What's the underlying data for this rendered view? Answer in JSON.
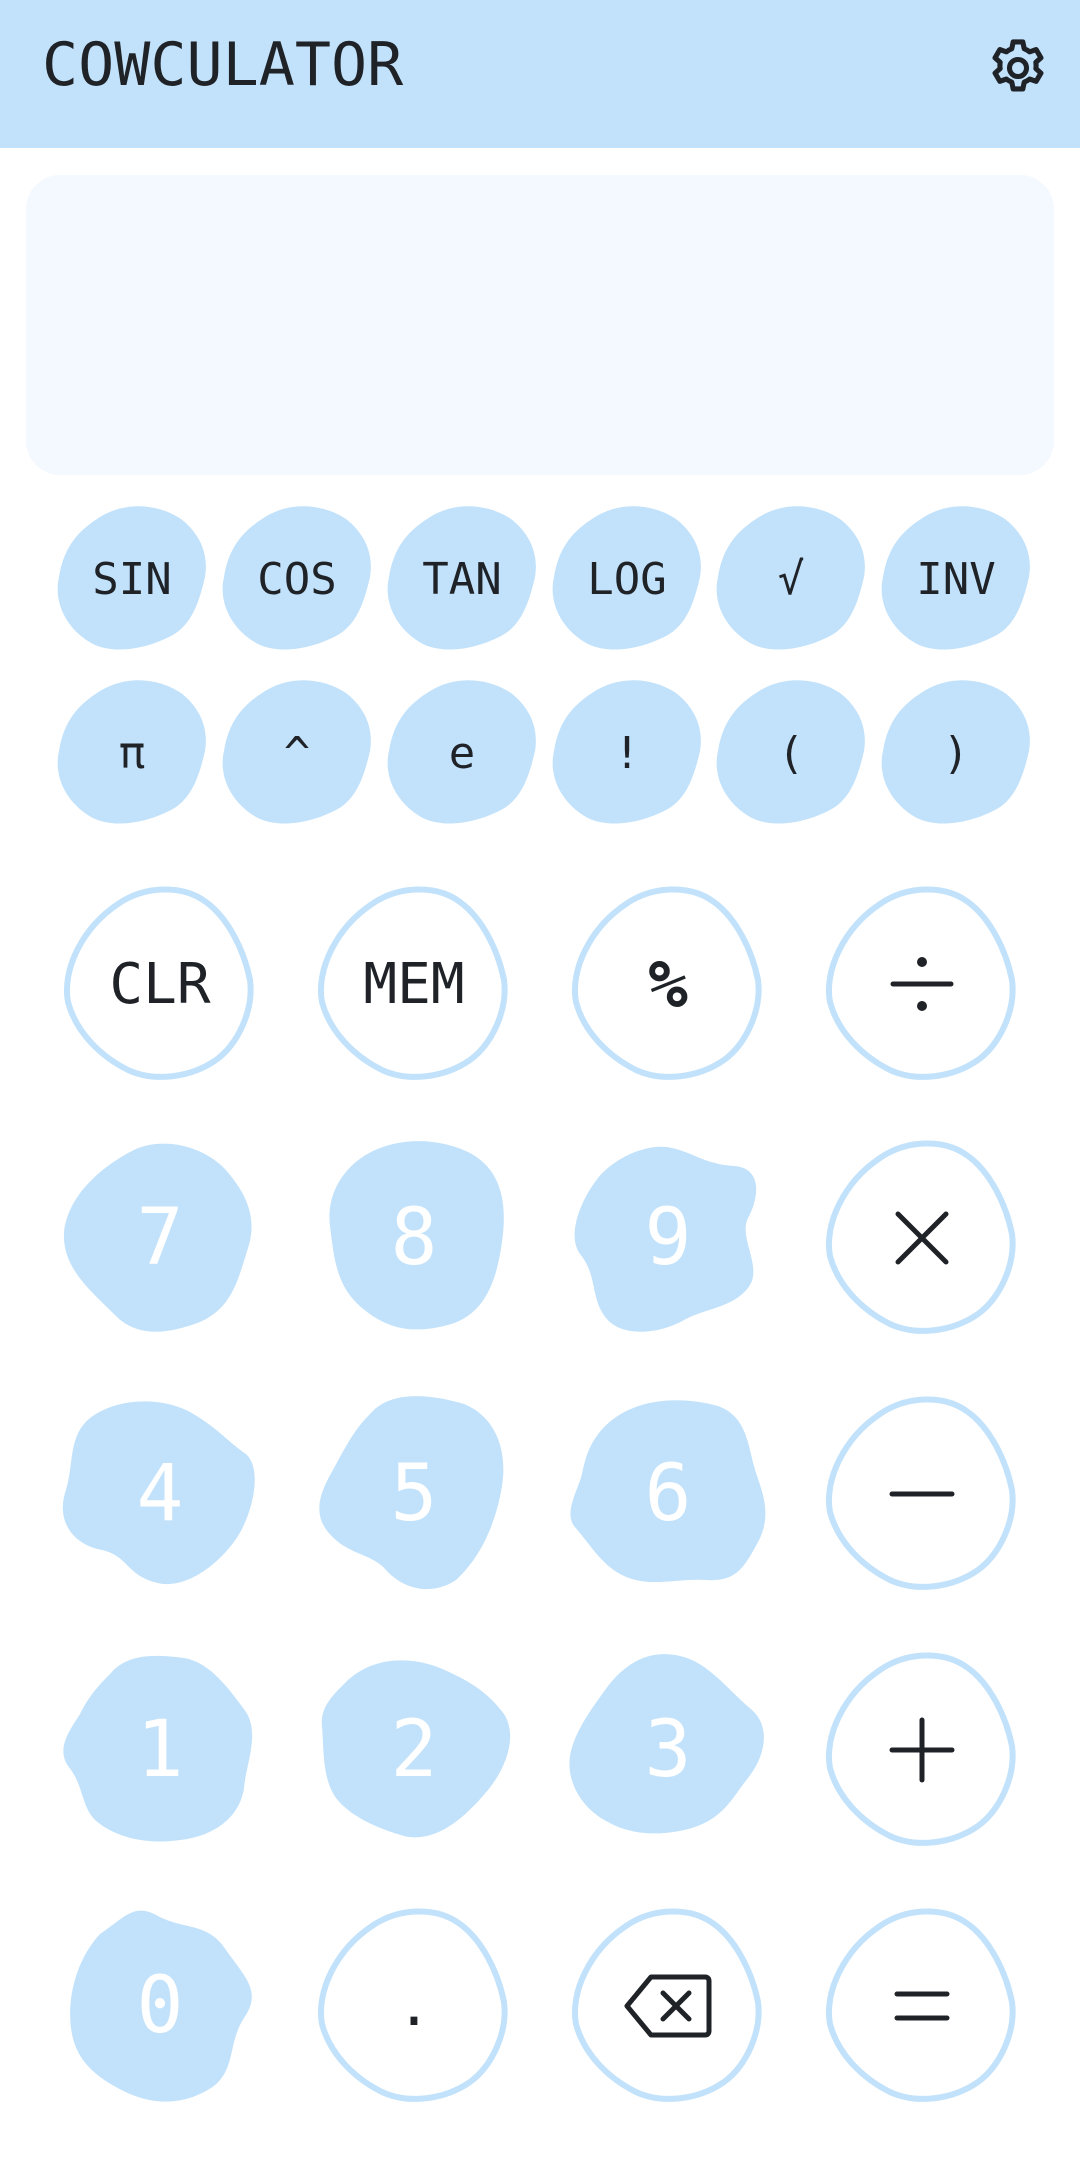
{
  "app": {
    "title": "COWCULATOR"
  },
  "display": {
    "value": ""
  },
  "colors": {
    "accent": "#c2e2fb",
    "outline": "#c2e2fb",
    "text": "#1f2328",
    "digit_text": "#ffffff",
    "display_bg": "#f3f9fe"
  },
  "scientific_row1": [
    "SIN",
    "COS",
    "TAN",
    "LOG",
    "√",
    "INV"
  ],
  "scientific_row2": [
    "π",
    "^",
    "e",
    "!",
    "(",
    ")"
  ],
  "ops": {
    "clear": "CLR",
    "memory": "MEM",
    "percent": "%",
    "decimal": "."
  },
  "digits": {
    "d7": "7",
    "d8": "8",
    "d9": "9",
    "d4": "4",
    "d5": "5",
    "d6": "6",
    "d1": "1",
    "d2": "2",
    "d3": "3",
    "d0": "0"
  },
  "icons": {
    "settings": "gear-icon",
    "divide": "divide-icon",
    "multiply": "multiply-icon",
    "minus": "minus-icon",
    "plus": "plus-icon",
    "backspace": "backspace-icon",
    "equals": "equals-icon"
  }
}
